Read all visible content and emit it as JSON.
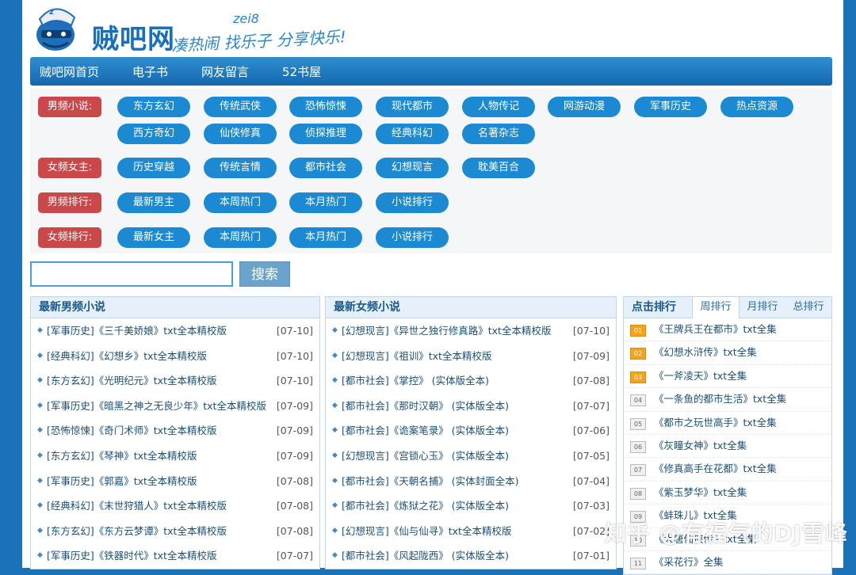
{
  "header": {
    "site_name": "贼吧网",
    "slogan": "凑热闹 找乐子 分享快乐!",
    "slogan_sub": "zei8"
  },
  "nav": [
    "贼吧网首页",
    "电子书",
    "网友留言",
    "52书屋"
  ],
  "categories": [
    {
      "label": "男频小说:",
      "tags": [
        "东方玄幻",
        "传统武侠",
        "恐怖惊悚",
        "现代都市",
        "人物传记",
        "网游动漫",
        "军事历史",
        "热点资源",
        "西方奇幻",
        "仙侠修真",
        "侦探推理",
        "经典科幻",
        "名著杂志"
      ]
    },
    {
      "label": "女频女主:",
      "tags": [
        "历史穿越",
        "传统言情",
        "都市社会",
        "幻想现言",
        "耽美百合"
      ]
    },
    {
      "label": "男频排行:",
      "tags": [
        "最新男主",
        "本周热门",
        "本月热门",
        "小说排行"
      ]
    },
    {
      "label": "女频排行:",
      "tags": [
        "最新女主",
        "本周热门",
        "本月热门",
        "小说排行"
      ]
    }
  ],
  "search": {
    "placeholder": "",
    "button": "搜索"
  },
  "male_list": {
    "title": "最新男频小说",
    "items": [
      {
        "text": "[军事历史]《三千美娇娘》txt全本精校版",
        "date": "[07-10]"
      },
      {
        "text": "[经典科幻]《幻想乡》txt全本精校版",
        "date": "[07-10]"
      },
      {
        "text": "[东方玄幻]《光明纪元》txt全本精校版",
        "date": "[07-10]"
      },
      {
        "text": "[军事历史]《暗黑之神之无良少年》txt全本精校版",
        "date": "[07-09]"
      },
      {
        "text": "[恐怖惊悚]《奇门术师》txt全本精校版",
        "date": "[07-09]"
      },
      {
        "text": "[东方玄幻]《琴神》txt全本精校版",
        "date": "[07-09]"
      },
      {
        "text": "[军事历史]《郭嘉》txt全本精校版",
        "date": "[07-08]"
      },
      {
        "text": "[经典科幻]《末世狩猎人》txt全本精校版",
        "date": "[07-08]"
      },
      {
        "text": "[东方玄幻]《东方云梦谭》txt全本精校版",
        "date": "[07-08]"
      },
      {
        "text": "[军事历史]《铁器时代》txt全本精校版",
        "date": "[07-07]"
      }
    ]
  },
  "female_list": {
    "title": "最新女频小说",
    "items": [
      {
        "text": "[幻想现言]《异世之独行修真路》txt全本精校版",
        "date": "[07-10]"
      },
      {
        "text": "[幻想现言]《祖训》txt全本精校版",
        "date": "[07-09]"
      },
      {
        "text": "[都市社会]《掌控》 (实体版全本)",
        "date": "[07-08]"
      },
      {
        "text": "[都市社会]《那时汉朝》 (实体版全本)",
        "date": "[07-07]"
      },
      {
        "text": "[都市社会]《诡案笔录》 (实体版全本)",
        "date": "[07-06]"
      },
      {
        "text": "[幻想现言]《宫锁心玉》 (实体版全本)",
        "date": "[07-05]"
      },
      {
        "text": "[都市社会]《天朝名捕》 (实体封面全本)",
        "date": "[07-04]"
      },
      {
        "text": "[都市社会]《炼狱之花》 (实体版全本)",
        "date": "[07-03]"
      },
      {
        "text": "[幻想现言]《仙与仙寻》txt全本精校版",
        "date": "[07-02]"
      },
      {
        "text": "[都市社会]《风起陇西》 (实体版全本)",
        "date": "[07-01]"
      }
    ]
  },
  "rank": {
    "title": "点击排行",
    "tabs": [
      "周排行",
      "月排行",
      "总排行"
    ],
    "items": [
      {
        "num": "01",
        "text": "《王牌兵王在都市》txt全集"
      },
      {
        "num": "02",
        "text": "《幻想水浒传》txt全集"
      },
      {
        "num": "03",
        "text": "《一斧凌天》txt全集"
      },
      {
        "num": "04",
        "text": "《一条鱼的都市生活》txt全集"
      },
      {
        "num": "05",
        "text": "《都市之玩世高手》txt全集"
      },
      {
        "num": "06",
        "text": "《灰瞳女神》txt全集"
      },
      {
        "num": "07",
        "text": "《修真高手在花都》txt全集"
      },
      {
        "num": "08",
        "text": "《紫玉梦华》txt全集"
      },
      {
        "num": "09",
        "text": "《蚌珠儿》txt全集"
      },
      {
        "num": "10",
        "text": "《大唐仙侠传》txt全集"
      },
      {
        "num": "11",
        "text": "《采花行》全集"
      }
    ]
  },
  "watermark": "知乎 @有福气的DJ雪峰"
}
